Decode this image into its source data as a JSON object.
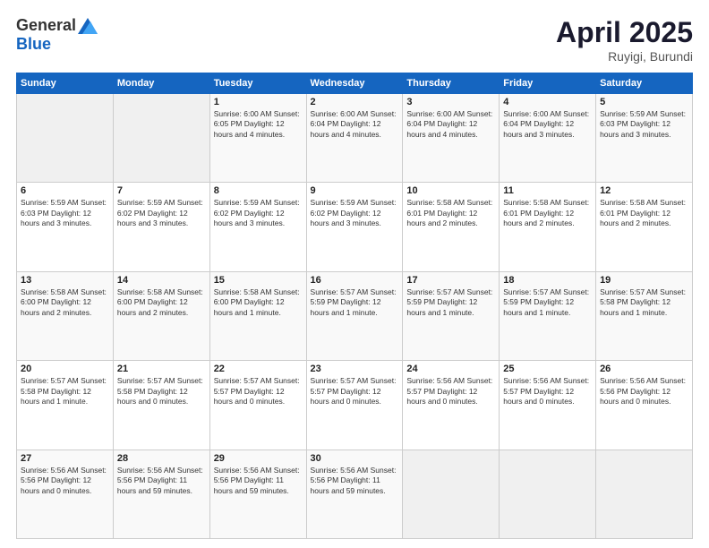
{
  "header": {
    "logo_general": "General",
    "logo_blue": "Blue",
    "month_title": "April 2025",
    "subtitle": "Ruyigi, Burundi"
  },
  "days_of_week": [
    "Sunday",
    "Monday",
    "Tuesday",
    "Wednesday",
    "Thursday",
    "Friday",
    "Saturday"
  ],
  "weeks": [
    [
      {
        "day": "",
        "info": ""
      },
      {
        "day": "",
        "info": ""
      },
      {
        "day": "1",
        "info": "Sunrise: 6:00 AM\nSunset: 6:05 PM\nDaylight: 12 hours\nand 4 minutes."
      },
      {
        "day": "2",
        "info": "Sunrise: 6:00 AM\nSunset: 6:04 PM\nDaylight: 12 hours\nand 4 minutes."
      },
      {
        "day": "3",
        "info": "Sunrise: 6:00 AM\nSunset: 6:04 PM\nDaylight: 12 hours\nand 4 minutes."
      },
      {
        "day": "4",
        "info": "Sunrise: 6:00 AM\nSunset: 6:04 PM\nDaylight: 12 hours\nand 3 minutes."
      },
      {
        "day": "5",
        "info": "Sunrise: 5:59 AM\nSunset: 6:03 PM\nDaylight: 12 hours\nand 3 minutes."
      }
    ],
    [
      {
        "day": "6",
        "info": "Sunrise: 5:59 AM\nSunset: 6:03 PM\nDaylight: 12 hours\nand 3 minutes."
      },
      {
        "day": "7",
        "info": "Sunrise: 5:59 AM\nSunset: 6:02 PM\nDaylight: 12 hours\nand 3 minutes."
      },
      {
        "day": "8",
        "info": "Sunrise: 5:59 AM\nSunset: 6:02 PM\nDaylight: 12 hours\nand 3 minutes."
      },
      {
        "day": "9",
        "info": "Sunrise: 5:59 AM\nSunset: 6:02 PM\nDaylight: 12 hours\nand 3 minutes."
      },
      {
        "day": "10",
        "info": "Sunrise: 5:58 AM\nSunset: 6:01 PM\nDaylight: 12 hours\nand 2 minutes."
      },
      {
        "day": "11",
        "info": "Sunrise: 5:58 AM\nSunset: 6:01 PM\nDaylight: 12 hours\nand 2 minutes."
      },
      {
        "day": "12",
        "info": "Sunrise: 5:58 AM\nSunset: 6:01 PM\nDaylight: 12 hours\nand 2 minutes."
      }
    ],
    [
      {
        "day": "13",
        "info": "Sunrise: 5:58 AM\nSunset: 6:00 PM\nDaylight: 12 hours\nand 2 minutes."
      },
      {
        "day": "14",
        "info": "Sunrise: 5:58 AM\nSunset: 6:00 PM\nDaylight: 12 hours\nand 2 minutes."
      },
      {
        "day": "15",
        "info": "Sunrise: 5:58 AM\nSunset: 6:00 PM\nDaylight: 12 hours\nand 1 minute."
      },
      {
        "day": "16",
        "info": "Sunrise: 5:57 AM\nSunset: 5:59 PM\nDaylight: 12 hours\nand 1 minute."
      },
      {
        "day": "17",
        "info": "Sunrise: 5:57 AM\nSunset: 5:59 PM\nDaylight: 12 hours\nand 1 minute."
      },
      {
        "day": "18",
        "info": "Sunrise: 5:57 AM\nSunset: 5:59 PM\nDaylight: 12 hours\nand 1 minute."
      },
      {
        "day": "19",
        "info": "Sunrise: 5:57 AM\nSunset: 5:58 PM\nDaylight: 12 hours\nand 1 minute."
      }
    ],
    [
      {
        "day": "20",
        "info": "Sunrise: 5:57 AM\nSunset: 5:58 PM\nDaylight: 12 hours\nand 1 minute."
      },
      {
        "day": "21",
        "info": "Sunrise: 5:57 AM\nSunset: 5:58 PM\nDaylight: 12 hours\nand 0 minutes."
      },
      {
        "day": "22",
        "info": "Sunrise: 5:57 AM\nSunset: 5:57 PM\nDaylight: 12 hours\nand 0 minutes."
      },
      {
        "day": "23",
        "info": "Sunrise: 5:57 AM\nSunset: 5:57 PM\nDaylight: 12 hours\nand 0 minutes."
      },
      {
        "day": "24",
        "info": "Sunrise: 5:56 AM\nSunset: 5:57 PM\nDaylight: 12 hours\nand 0 minutes."
      },
      {
        "day": "25",
        "info": "Sunrise: 5:56 AM\nSunset: 5:57 PM\nDaylight: 12 hours\nand 0 minutes."
      },
      {
        "day": "26",
        "info": "Sunrise: 5:56 AM\nSunset: 5:56 PM\nDaylight: 12 hours\nand 0 minutes."
      }
    ],
    [
      {
        "day": "27",
        "info": "Sunrise: 5:56 AM\nSunset: 5:56 PM\nDaylight: 12 hours\nand 0 minutes."
      },
      {
        "day": "28",
        "info": "Sunrise: 5:56 AM\nSunset: 5:56 PM\nDaylight: 11 hours\nand 59 minutes."
      },
      {
        "day": "29",
        "info": "Sunrise: 5:56 AM\nSunset: 5:56 PM\nDaylight: 11 hours\nand 59 minutes."
      },
      {
        "day": "30",
        "info": "Sunrise: 5:56 AM\nSunset: 5:56 PM\nDaylight: 11 hours\nand 59 minutes."
      },
      {
        "day": "",
        "info": ""
      },
      {
        "day": "",
        "info": ""
      },
      {
        "day": "",
        "info": ""
      }
    ]
  ]
}
